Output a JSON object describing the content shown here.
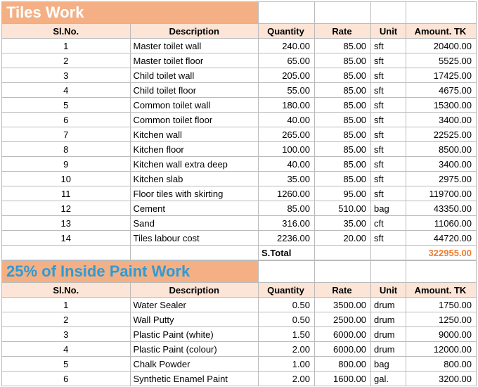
{
  "section1": {
    "title": "Tiles Work",
    "headers": {
      "sl": "Sl.No.",
      "desc": "Description",
      "qty": "Quantity",
      "rate": "Rate",
      "unit": "Unit",
      "amt": "Amount. TK"
    },
    "rows": [
      {
        "sl": "1",
        "desc": "Master toilet wall",
        "qty": "240.00",
        "rate": "85.00",
        "unit": "sft",
        "amt": "20400.00"
      },
      {
        "sl": "2",
        "desc": "Master toilet floor",
        "qty": "65.00",
        "rate": "85.00",
        "unit": "sft",
        "amt": "5525.00"
      },
      {
        "sl": "3",
        "desc": "Child toilet wall",
        "qty": "205.00",
        "rate": "85.00",
        "unit": "sft",
        "amt": "17425.00"
      },
      {
        "sl": "4",
        "desc": "Child toilet floor",
        "qty": "55.00",
        "rate": "85.00",
        "unit": "sft",
        "amt": "4675.00"
      },
      {
        "sl": "5",
        "desc": "Common toilet wall",
        "qty": "180.00",
        "rate": "85.00",
        "unit": "sft",
        "amt": "15300.00"
      },
      {
        "sl": "6",
        "desc": "Common toilet floor",
        "qty": "40.00",
        "rate": "85.00",
        "unit": "sft",
        "amt": "3400.00"
      },
      {
        "sl": "7",
        "desc": "Kitchen wall",
        "qty": "265.00",
        "rate": "85.00",
        "unit": "sft",
        "amt": "22525.00"
      },
      {
        "sl": "8",
        "desc": "Kitchen floor",
        "qty": "100.00",
        "rate": "85.00",
        "unit": "sft",
        "amt": "8500.00"
      },
      {
        "sl": "9",
        "desc": "Kitchen wall extra deep",
        "qty": "40.00",
        "rate": "85.00",
        "unit": "sft",
        "amt": "3400.00"
      },
      {
        "sl": "10",
        "desc": "Kitchen slab",
        "qty": "35.00",
        "rate": "85.00",
        "unit": "sft",
        "amt": "2975.00"
      },
      {
        "sl": "11",
        "desc": "Floor tiles with skirting",
        "qty": "1260.00",
        "rate": "95.00",
        "unit": "sft",
        "amt": "119700.00"
      },
      {
        "sl": "12",
        "desc": "Cement",
        "qty": "85.00",
        "rate": "510.00",
        "unit": "bag",
        "amt": "43350.00"
      },
      {
        "sl": "13",
        "desc": "Sand",
        "qty": "316.00",
        "rate": "35.00",
        "unit": "cft",
        "amt": "11060.00"
      },
      {
        "sl": "14",
        "desc": "Tiles labour cost",
        "qty": "2236.00",
        "rate": "20.00",
        "unit": "sft",
        "amt": "44720.00"
      }
    ],
    "subtotal": {
      "label": "S.Total",
      "amt": "322955.00"
    }
  },
  "section2": {
    "title": "25% of Inside Paint Work",
    "headers": {
      "sl": "Sl.No.",
      "desc": "Description",
      "qty": "Quantity",
      "rate": "Rate",
      "unit": "Unit",
      "amt": "Amount. TK"
    },
    "rows": [
      {
        "sl": "1",
        "desc": "Water Sealer",
        "qty": "0.50",
        "rate": "3500.00",
        "unit": "drum",
        "amt": "1750.00"
      },
      {
        "sl": "2",
        "desc": "Wall Putty",
        "qty": "0.50",
        "rate": "2500.00",
        "unit": "drum",
        "amt": "1250.00"
      },
      {
        "sl": "3",
        "desc": "Plastic Paint (white)",
        "qty": "1.50",
        "rate": "6000.00",
        "unit": "drum",
        "amt": "9000.00"
      },
      {
        "sl": "4",
        "desc": "Plastic Paint (colour)",
        "qty": "2.00",
        "rate": "6000.00",
        "unit": "drum",
        "amt": "12000.00"
      },
      {
        "sl": "5",
        "desc": "Chalk Powder",
        "qty": "1.00",
        "rate": "800.00",
        "unit": "bag",
        "amt": "800.00"
      },
      {
        "sl": "6",
        "desc": "Synthetic Enamel Paint",
        "qty": "2.00",
        "rate": "1600.00",
        "unit": "gal.",
        "amt": "3200.00"
      }
    ]
  },
  "chart_data": {
    "type": "table",
    "tables": [
      {
        "title": "Tiles Work",
        "columns": [
          "Sl.No.",
          "Description",
          "Quantity",
          "Rate",
          "Unit",
          "Amount. TK"
        ],
        "rows": [
          [
            1,
            "Master toilet wall",
            240.0,
            85.0,
            "sft",
            20400.0
          ],
          [
            2,
            "Master toilet floor",
            65.0,
            85.0,
            "sft",
            5525.0
          ],
          [
            3,
            "Child toilet wall",
            205.0,
            85.0,
            "sft",
            17425.0
          ],
          [
            4,
            "Child toilet floor",
            55.0,
            85.0,
            "sft",
            4675.0
          ],
          [
            5,
            "Common toilet wall",
            180.0,
            85.0,
            "sft",
            15300.0
          ],
          [
            6,
            "Common toilet floor",
            40.0,
            85.0,
            "sft",
            3400.0
          ],
          [
            7,
            "Kitchen wall",
            265.0,
            85.0,
            "sft",
            22525.0
          ],
          [
            8,
            "Kitchen floor",
            100.0,
            85.0,
            "sft",
            8500.0
          ],
          [
            9,
            "Kitchen wall extra deep",
            40.0,
            85.0,
            "sft",
            3400.0
          ],
          [
            10,
            "Kitchen slab",
            35.0,
            85.0,
            "sft",
            2975.0
          ],
          [
            11,
            "Floor tiles with skirting",
            1260.0,
            95.0,
            "sft",
            119700.0
          ],
          [
            12,
            "Cement",
            85.0,
            510.0,
            "bag",
            43350.0
          ],
          [
            13,
            "Sand",
            316.0,
            35.0,
            "cft",
            11060.0
          ],
          [
            14,
            "Tiles labour cost",
            2236.0,
            20.0,
            "sft",
            44720.0
          ]
        ],
        "subtotal": 322955.0
      },
      {
        "title": "25% of Inside Paint Work",
        "columns": [
          "Sl.No.",
          "Description",
          "Quantity",
          "Rate",
          "Unit",
          "Amount. TK"
        ],
        "rows": [
          [
            1,
            "Water Sealer",
            0.5,
            3500.0,
            "drum",
            1750.0
          ],
          [
            2,
            "Wall Putty",
            0.5,
            2500.0,
            "drum",
            1250.0
          ],
          [
            3,
            "Plastic Paint (white)",
            1.5,
            6000.0,
            "drum",
            9000.0
          ],
          [
            4,
            "Plastic Paint (colour)",
            2.0,
            6000.0,
            "drum",
            12000.0
          ],
          [
            5,
            "Chalk Powder",
            1.0,
            800.0,
            "bag",
            800.0
          ],
          [
            6,
            "Synthetic Enamel Paint",
            2.0,
            1600.0,
            "gal.",
            3200.0
          ]
        ]
      }
    ]
  }
}
